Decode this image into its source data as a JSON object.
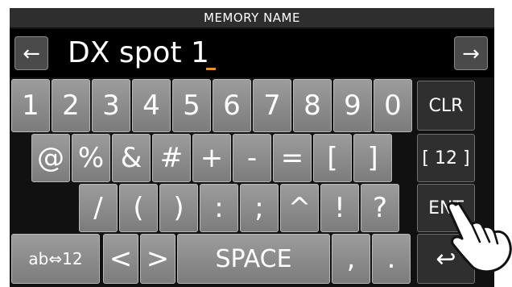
{
  "title": "MEMORY NAME",
  "input": {
    "value": "DX spot 1",
    "left_arrow": "←",
    "right_arrow": "→"
  },
  "keys": {
    "row1": [
      "1",
      "2",
      "3",
      "4",
      "5",
      "6",
      "7",
      "8",
      "9",
      "0"
    ],
    "row2": [
      "@",
      "%",
      "&",
      "#",
      "+",
      "-",
      "=",
      "[",
      "]"
    ],
    "row3": [
      "/",
      "(",
      ")",
      ":",
      ";",
      "^",
      "!",
      "?"
    ],
    "row4": {
      "mode": "ab⇔12",
      "lt": "<",
      "gt": ">",
      "space": "SPACE",
      "comma": ",",
      "period": "."
    }
  },
  "side_keys": {
    "clr": "CLR",
    "page": "[ 12 ]",
    "ent": "ENT",
    "back": "↩"
  },
  "colors": {
    "accent_cursor": "#e8902a",
    "key_gray": "#8c8c8c",
    "key_dark": "#2f2f2f"
  }
}
